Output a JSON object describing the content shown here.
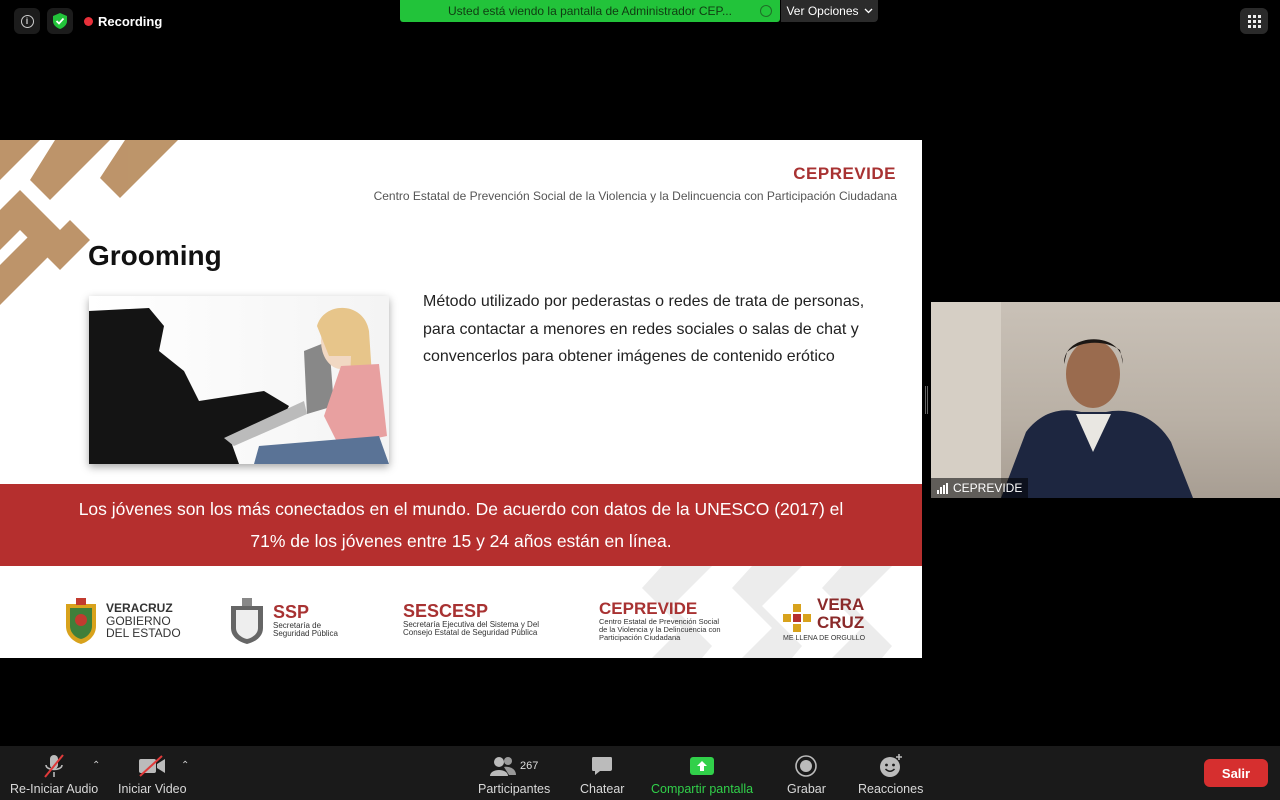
{
  "top": {
    "recording_label": "Recording",
    "share_banner": "Usted está viendo la pantalla de Administrador CEP...",
    "view_options": "Ver Opciones"
  },
  "slide": {
    "brand": "CEPREVIDE",
    "subtitle": "Centro Estatal de Prevención Social de la Violencia y la Delincuencia con Participación Ciudadana",
    "title": "Grooming",
    "body": "Método utilizado por pederastas o redes de trata de personas, para contactar a menores en redes sociales o salas de chat y convencerlos para obtener imágenes de contenido erótico",
    "band_text": "Los jóvenes son los más conectados en el mundo. De acuerdo con datos de la UNESCO (2017) el 71% de los jóvenes entre 15 y 24 años están en línea.",
    "logos": {
      "veracruz": [
        "VERACRUZ",
        "GOBIERNO",
        "DEL ESTADO"
      ],
      "ssp": {
        "name": "SSP",
        "line1": "Secretaría de",
        "line2": "Seguridad Pública"
      },
      "sescesp": {
        "name": "SESCESP",
        "line1": "Secretaría Ejecutiva del Sistema y Del",
        "line2": "Consejo Estatal de Seguridad Pública"
      },
      "ceprevide": {
        "name": "CEPREVIDE",
        "line1": "Centro Estatal de Prevención Social",
        "line2": "de la Violencia y la Delincuencia con",
        "line3": "Participación Ciudadana"
      },
      "veracruz_brand": {
        "line1": "VERA",
        "line2": "CRUZ",
        "tagline": "ME LLENA DE ORGULLO"
      }
    }
  },
  "participant": {
    "name": "CEPREVIDE"
  },
  "toolbar": {
    "audio_label": "Re-Iniciar Audio",
    "video_label": "Iniciar Video",
    "participants_label": "Participantes",
    "participants_count": "267",
    "chat_label": "Chatear",
    "share_label": "Compartir pantalla",
    "record_label": "Grabar",
    "reactions_label": "Reacciones",
    "leave_label": "Salir"
  },
  "colors": {
    "accent_red": "#b52f2e",
    "share_green": "#22c33a",
    "leave_red": "#d62f2f"
  }
}
